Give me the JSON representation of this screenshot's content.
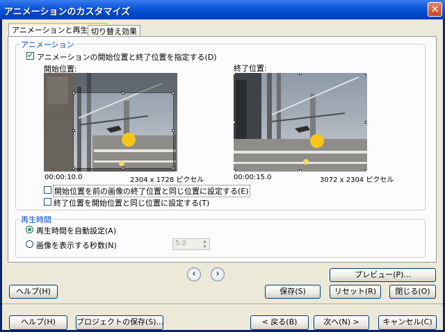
{
  "window": {
    "title": "アニメーションのカスタマイズ",
    "close_glyph": "✕"
  },
  "tabs": [
    {
      "label": "アニメーションと再生時間",
      "active": true
    },
    {
      "label": "切り替え効果",
      "active": false
    }
  ],
  "animation_group": {
    "legend": "アニメーション",
    "specify_checkbox": {
      "label": "アニメーションの開始位置と終了位置を指定する(D)",
      "checked": true
    },
    "start": {
      "heading": "開始位置:",
      "time": "00:00:10.0",
      "size": "2304 x 1728 ピクセル"
    },
    "end": {
      "heading": "終了位置:",
      "time": "00:00:15.0",
      "size": "3072 x 2304 ピクセル"
    },
    "option1": {
      "label": "開始位置を前の画像の終了位置と同じ位置に設定する(E)",
      "checked": false
    },
    "option2": {
      "label": "終了位置を開始位置と同じ位置に設定する(T)",
      "checked": false
    }
  },
  "playback_group": {
    "legend": "再生時間",
    "auto": {
      "label": "再生時間を自動設定(A)",
      "selected": true
    },
    "manual": {
      "label": "画像を表示する秒数(N)",
      "selected": false
    },
    "seconds": "5.0"
  },
  "panel_buttons": {
    "prev_icon": "chevron-left-icon",
    "next_icon": "chevron-right-icon",
    "preview": "プレビュー(P)...",
    "help": "ヘルプ(H)",
    "save": "保存(S)",
    "reset": "リセット(R)",
    "close": "閉じる(O)"
  },
  "wizard_buttons": {
    "help": "ヘルプ(H)",
    "save_project": "プロジェクトの保存(S)...",
    "back": "< 戻る(B)",
    "next": "次へ(N) >",
    "cancel": "キャンセル(C)"
  }
}
